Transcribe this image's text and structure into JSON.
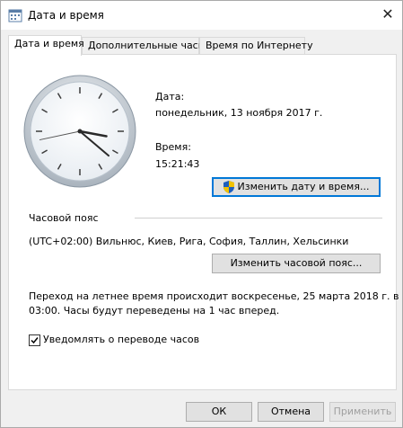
{
  "window": {
    "title": "Дата и время",
    "close_glyph": "✕"
  },
  "tabs": [
    {
      "label": "Дата и время",
      "active": true
    },
    {
      "label": "Дополнительные часы",
      "active": false
    },
    {
      "label": "Время по Интернету",
      "active": false
    }
  ],
  "clock": {
    "time": "15:21:43"
  },
  "date": {
    "label": "Дата:",
    "value": "понедельник, 13 ноября 2017 г."
  },
  "time": {
    "label": "Время:",
    "value": "15:21:43"
  },
  "change_datetime_button": "Изменить дату и время...",
  "timezone": {
    "section_label": "Часовой пояс",
    "value": "(UTC+02:00) Вильнюс, Киев, Рига, София, Таллин, Хельсинки",
    "change_button": "Изменить часовой пояс..."
  },
  "dst": {
    "line1": "Переход на летнее время происходит воскресенье, 25 марта 2018 г. в",
    "line2": "03:00. Часы будут переведены на 1 час вперед."
  },
  "notify": {
    "label": "Уведомлять о переводе часов",
    "checked": true
  },
  "footer": {
    "ok": "ОК",
    "cancel": "Отмена",
    "apply": "Применить"
  },
  "colors": {
    "focus_border": "#0078d7",
    "shield_blue": "#1e5fbf",
    "shield_yellow": "#f2c200"
  }
}
